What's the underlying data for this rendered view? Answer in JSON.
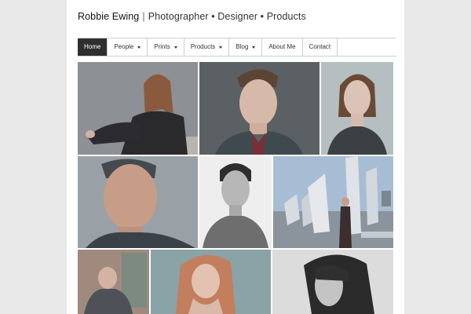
{
  "site": {
    "name": "Robbie Ewing",
    "separator": "|",
    "tagline": "Photographer • Designer • Products"
  },
  "nav": {
    "items": [
      {
        "label": "Home",
        "active": true,
        "dropdown": false
      },
      {
        "label": "People",
        "active": false,
        "dropdown": true
      },
      {
        "label": "Prints",
        "active": false,
        "dropdown": true
      },
      {
        "label": "Products",
        "active": false,
        "dropdown": true
      },
      {
        "label": "Blog",
        "active": false,
        "dropdown": true
      },
      {
        "label": "About Me",
        "active": false,
        "dropdown": false
      },
      {
        "label": "Contact",
        "active": false,
        "dropdown": false
      }
    ]
  },
  "colors": {
    "nav_active_bg": "#2f2f2f",
    "page_bg": "#ffffff",
    "body_bg": "#e9e9e9"
  }
}
